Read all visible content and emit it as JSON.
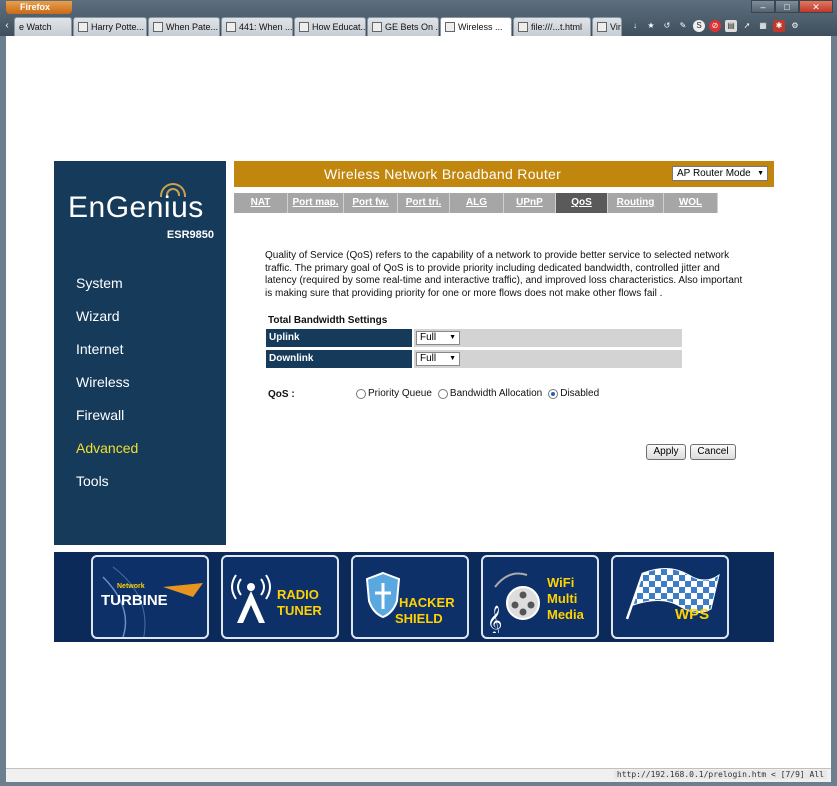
{
  "browser": {
    "menu_label": "Firefox",
    "tabs": [
      {
        "label": "e Watch",
        "active": false
      },
      {
        "label": "Harry Potte...",
        "active": false
      },
      {
        "label": "When Pate...",
        "active": false
      },
      {
        "label": "441: When ...",
        "active": false
      },
      {
        "label": "How Educat...",
        "active": false
      },
      {
        "label": "GE Bets On ...",
        "active": false
      },
      {
        "label": "Wireless ...",
        "active": true
      },
      {
        "label": "file:///...t.html",
        "active": false
      },
      {
        "label": "Vir",
        "active": false
      }
    ],
    "status_url": "http://192.168.0.1/prelogin.htm < [7/9] All"
  },
  "router": {
    "brand": "EnGenius",
    "model": "ESR9850",
    "header_title": "Wireless Network Broadband Router",
    "mode_select": "AP Router Mode",
    "nav": [
      "System",
      "Wizard",
      "Internet",
      "Wireless",
      "Firewall",
      "Advanced",
      "Tools"
    ],
    "active_nav": "Advanced",
    "subtabs": [
      "NAT",
      "Port map.",
      "Port fw.",
      "Port tri.",
      "ALG",
      "UPnP",
      "QoS",
      "Routing",
      "WOL"
    ],
    "active_subtab": "QoS",
    "description": "Quality of Service (QoS) refers to the capability of a network to provide better service to selected network traffic. The primary goal of QoS is to provide priority including dedicated bandwidth, controlled jitter and latency (required by some real-time and interactive traffic), and improved loss characteristics. Also important is making sure that providing priority for one or more flows does not make other flows fail .",
    "bandwidth": {
      "title": "Total Bandwidth Settings",
      "uplink_label": "Uplink",
      "uplink_value": "Full",
      "downlink_label": "Downlink",
      "downlink_value": "Full"
    },
    "qos": {
      "label": "QoS :",
      "options": [
        "Priority Queue",
        "Bandwidth Allocation",
        "Disabled"
      ],
      "selected": "Disabled"
    },
    "apply_label": "Apply",
    "cancel_label": "Cancel",
    "features": [
      {
        "line1": "Network",
        "line2": "TURBINE"
      },
      {
        "line1": "RADIO",
        "line2": "TUNER"
      },
      {
        "line1": "HACKER",
        "line2": "SHIELD"
      },
      {
        "line1": "WiFi",
        "line2": "Multi",
        "line3": "Media"
      },
      {
        "line1": "WPS"
      }
    ]
  }
}
